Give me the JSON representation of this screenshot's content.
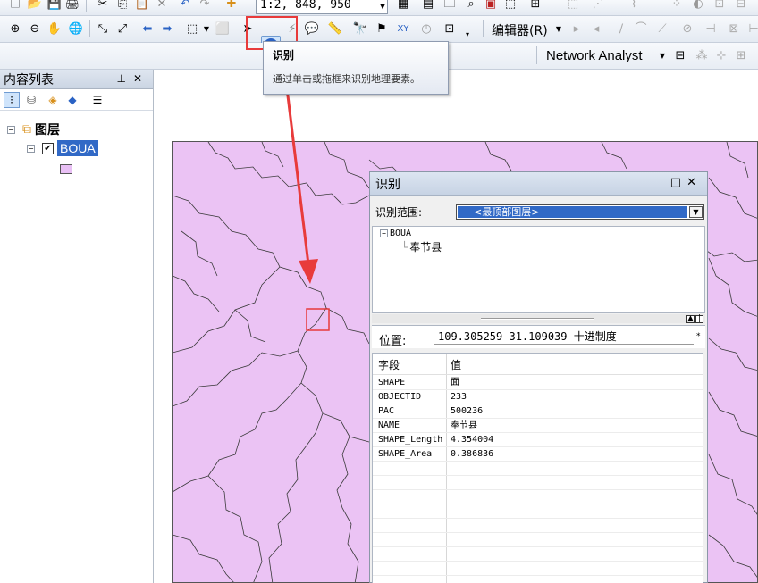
{
  "toolbar": {
    "scale_value": "1:2, 848, 950",
    "editor_label": "编辑器(R)",
    "network_analyst_label": "Network Analyst"
  },
  "tooltip": {
    "title": "识别",
    "description": "通过单击或拖框来识别地理要素。"
  },
  "toc": {
    "title": "内容列表",
    "root_label": "图层",
    "layer_name": "BOUA",
    "layer_fill_color": "#e9c0f5"
  },
  "identify": {
    "title": "识别",
    "scope_label": "识别范围:",
    "scope_value": "<最顶部图层>",
    "tree_layer": "BOUA",
    "tree_feature": "奉节县",
    "location_label": "位置:",
    "location_value": "109.305259   31.109039 十进制度",
    "columns": [
      "字段",
      "值"
    ],
    "rows": [
      {
        "field": "SHAPE",
        "value": "面"
      },
      {
        "field": "OBJECTID",
        "value": "233"
      },
      {
        "field": "PAC",
        "value": "500236"
      },
      {
        "field": "NAME",
        "value": "奉节县"
      },
      {
        "field": "SHAPE_Length",
        "value": "4.354004"
      },
      {
        "field": "SHAPE_Area",
        "value": "0.386836"
      }
    ]
  },
  "colors": {
    "map_fill": "#ebc3f4",
    "selection_blue": "#3169c6",
    "annotation_red": "#e83b3b"
  }
}
